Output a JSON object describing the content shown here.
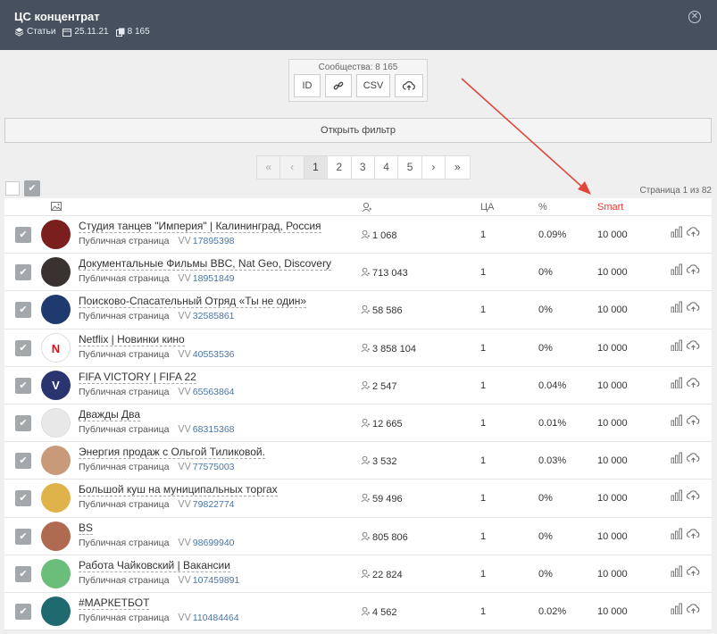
{
  "header": {
    "title": "ЦС концентрат",
    "type_label": "Статьи",
    "date": "25.11.21",
    "count": "8 165"
  },
  "communities": {
    "label": "Сообщества: 8 165",
    "buttons": [
      "ID",
      "CSV"
    ]
  },
  "filter_label": "Открыть фильтр",
  "pagination": {
    "items": [
      "«",
      "‹",
      "1",
      "2",
      "3",
      "4",
      "5",
      "›",
      "»"
    ],
    "active": "1"
  },
  "page_info": "Страница 1 из 82",
  "table": {
    "headers": {
      "ca": "ЦА",
      "pct": "%",
      "smart": "Smart"
    },
    "rows": [
      {
        "name": "Студия танцев \"Империя\" | Калининград, Россия",
        "type": "Публичная страница",
        "id": "17895398",
        "subs": "1 068",
        "ca": "1",
        "pct": "0.09%",
        "smart": "10 000",
        "avatar_color": "#7a1e1e"
      },
      {
        "name": "Документальные Фильмы BBC, Nat Geo, Discovery",
        "type": "Публичная страница",
        "id": "18951849",
        "subs": "713 043",
        "ca": "1",
        "pct": "0%",
        "smart": "10 000",
        "avatar_color": "#3a3230"
      },
      {
        "name": "Поисково-Спасательный Отряд «Ты не один»",
        "type": "Публичная страница",
        "id": "32585861",
        "subs": "58 586",
        "ca": "1",
        "pct": "0%",
        "smart": "10 000",
        "avatar_color": "#1e3a6e"
      },
      {
        "name": "Netflix | Новинки кино",
        "type": "Публичная страница",
        "id": "40553536",
        "subs": "3 858 104",
        "ca": "1",
        "pct": "0%",
        "smart": "10 000",
        "avatar_color": "#ffffff",
        "avatar_text": "N"
      },
      {
        "name": "FIFA VICTORY | FIFA 22",
        "type": "Публичная страница",
        "id": "65563864",
        "subs": "2 547",
        "ca": "1",
        "pct": "0.04%",
        "smart": "10 000",
        "avatar_color": "#2a3570",
        "avatar_text": "V"
      },
      {
        "name": "Дважды Два",
        "type": "Публичная страница",
        "id": "68315368",
        "subs": "12 665",
        "ca": "1",
        "pct": "0.01%",
        "smart": "10 000",
        "avatar_color": "#e8e8e8"
      },
      {
        "name": "Энергия продаж с Ольгой Тиликовой.",
        "type": "Публичная страница",
        "id": "77575003",
        "subs": "3 532",
        "ca": "1",
        "pct": "0.03%",
        "smart": "10 000",
        "avatar_color": "#c89a7a"
      },
      {
        "name": "Большой куш на муниципальных торгах",
        "type": "Публичная страница",
        "id": "79822774",
        "subs": "59 496",
        "ca": "1",
        "pct": "0%",
        "smart": "10 000",
        "avatar_color": "#e0b24a"
      },
      {
        "name": "BS",
        "type": "Публичная страница",
        "id": "98699940",
        "subs": "805 806",
        "ca": "1",
        "pct": "0%",
        "smart": "10 000",
        "avatar_color": "#b06a52"
      },
      {
        "name": "Работа Чайковский | Вакансии",
        "type": "Публичная страница",
        "id": "107459891",
        "subs": "22 824",
        "ca": "1",
        "pct": "0%",
        "smart": "10 000",
        "avatar_color": "#6bbd7a"
      },
      {
        "name": "#МАРКЕТБОТ",
        "type": "Публичная страница",
        "id": "110484464",
        "subs": "4 562",
        "ca": "1",
        "pct": "0.02%",
        "smart": "10 000",
        "avatar_color": "#1f6a6e"
      }
    ]
  },
  "colors": {
    "header_bg": "#46505f",
    "smart_header": "#e53935",
    "link": "#4a76a8",
    "annotation_arrow": "#e0473a"
  }
}
